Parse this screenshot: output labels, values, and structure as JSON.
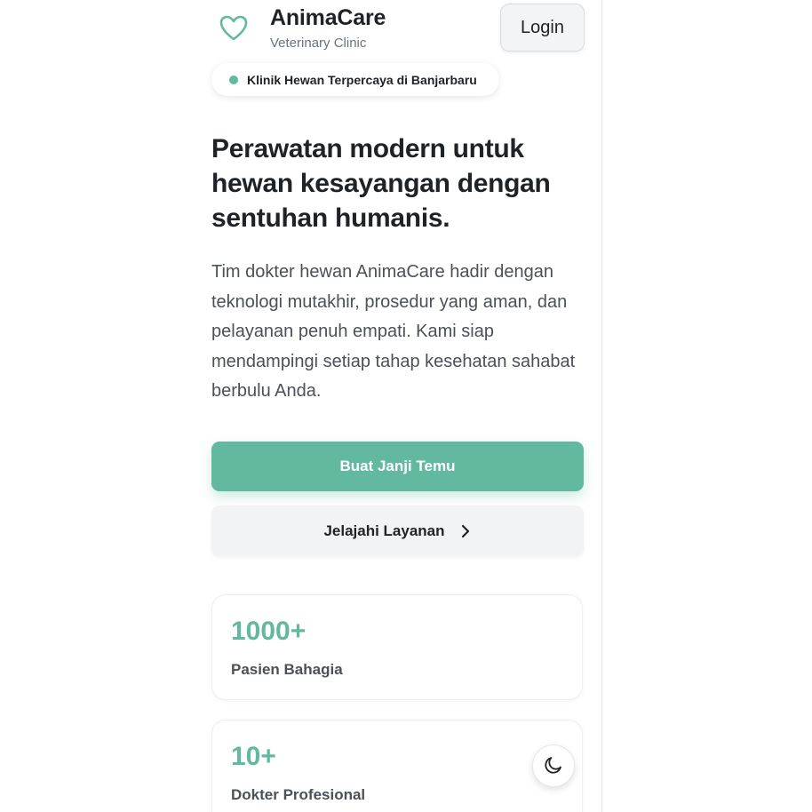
{
  "header": {
    "brand_name": "AnimaCare",
    "brand_subtitle": "Veterinary Clinic",
    "login_label": "Login",
    "logo_icon": "heart-icon"
  },
  "badge": {
    "text": "Klinik Hewan Terpercaya di Banjarbaru"
  },
  "hero": {
    "title": "Perawatan modern untuk hewan kesayangan dengan sentuhan humanis.",
    "description": "Tim dokter hewan AnimaCare hadir dengan teknologi mutakhir, prosedur yang aman, dan pelayanan penuh empati. Kami siap mendampingi setiap tahap kesehatan sahabat berbulu Anda."
  },
  "actions": {
    "primary_label": "Buat Janji Temu",
    "secondary_label": "Jelajahi Layanan",
    "secondary_icon": "chevron-right-icon"
  },
  "stats": [
    {
      "value": "1000+",
      "label": "Pasien Bahagia"
    },
    {
      "value": "10+",
      "label": "Dokter Profesional"
    }
  ],
  "theme_toggle_icon": "moon-icon",
  "colors": {
    "accent": "#63b8a0",
    "text": "#1f2227",
    "muted": "#4b5059"
  }
}
